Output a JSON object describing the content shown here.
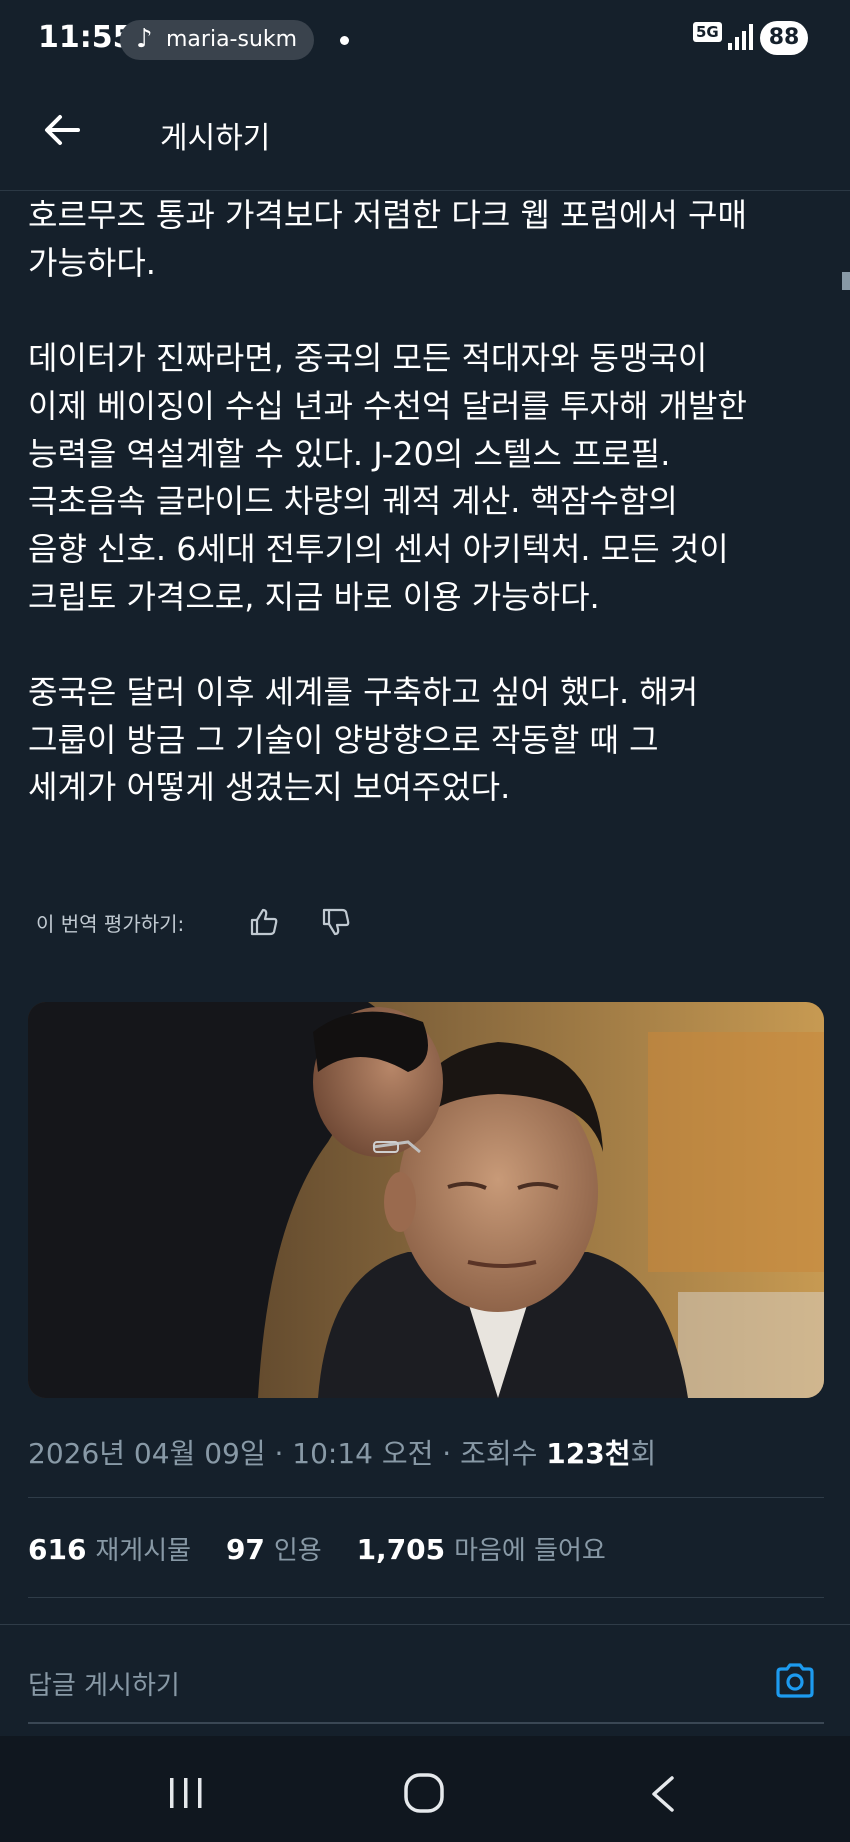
{
  "status_bar": {
    "time": "11:55",
    "music_label": "maria-sukm",
    "network": "5G",
    "battery": "88"
  },
  "header": {
    "title": "게시하기"
  },
  "post": {
    "paragraphs": [
      [
        "호르무즈 통과 가격보다 저렴한 다크 웹 포럼에서 구매",
        "가능하다."
      ],
      [
        "데이터가 진짜라면, 중국의 모든 적대자와 동맹국이",
        "이제 베이징이 수십 년과 수천억 달러를 투자해 개발한",
        "능력을 역설계할 수 있다. J-20의 스텔스 프로필.",
        "극초음속 글라이드 차량의 궤적 계산. 핵잠수함의",
        "음향 신호. 6세대 전투기의 센서 아키텍처. 모든 것이",
        "크립토 가격으로, 지금 바로 이용 가능하다."
      ],
      [
        "중국은 달러 이후 세계를 구축하고 싶어 했다. 해커",
        "그룹이 방금 그 기술이 양방향으로 작동할 때 그",
        "세계가 어떻게 생겼는지 보여주었다."
      ]
    ],
    "translate_prompt": "이 번역 평가하기:",
    "timestamp": "2026년 04월 09일 · 10:14 오전 · 조회수 ",
    "views_count": "123천",
    "views_suffix": "회"
  },
  "stats": {
    "reposts_count": "616",
    "reposts_label": "재게시물",
    "quotes_count": "97",
    "quotes_label": "인용",
    "likes_count": "1,705",
    "likes_label": "마음에 들어요"
  },
  "reply": {
    "placeholder": "답글 게시하기"
  },
  "colors": {
    "background": "#15202b",
    "secondary_text": "#8899a6",
    "accent": "#1d9bf0"
  }
}
